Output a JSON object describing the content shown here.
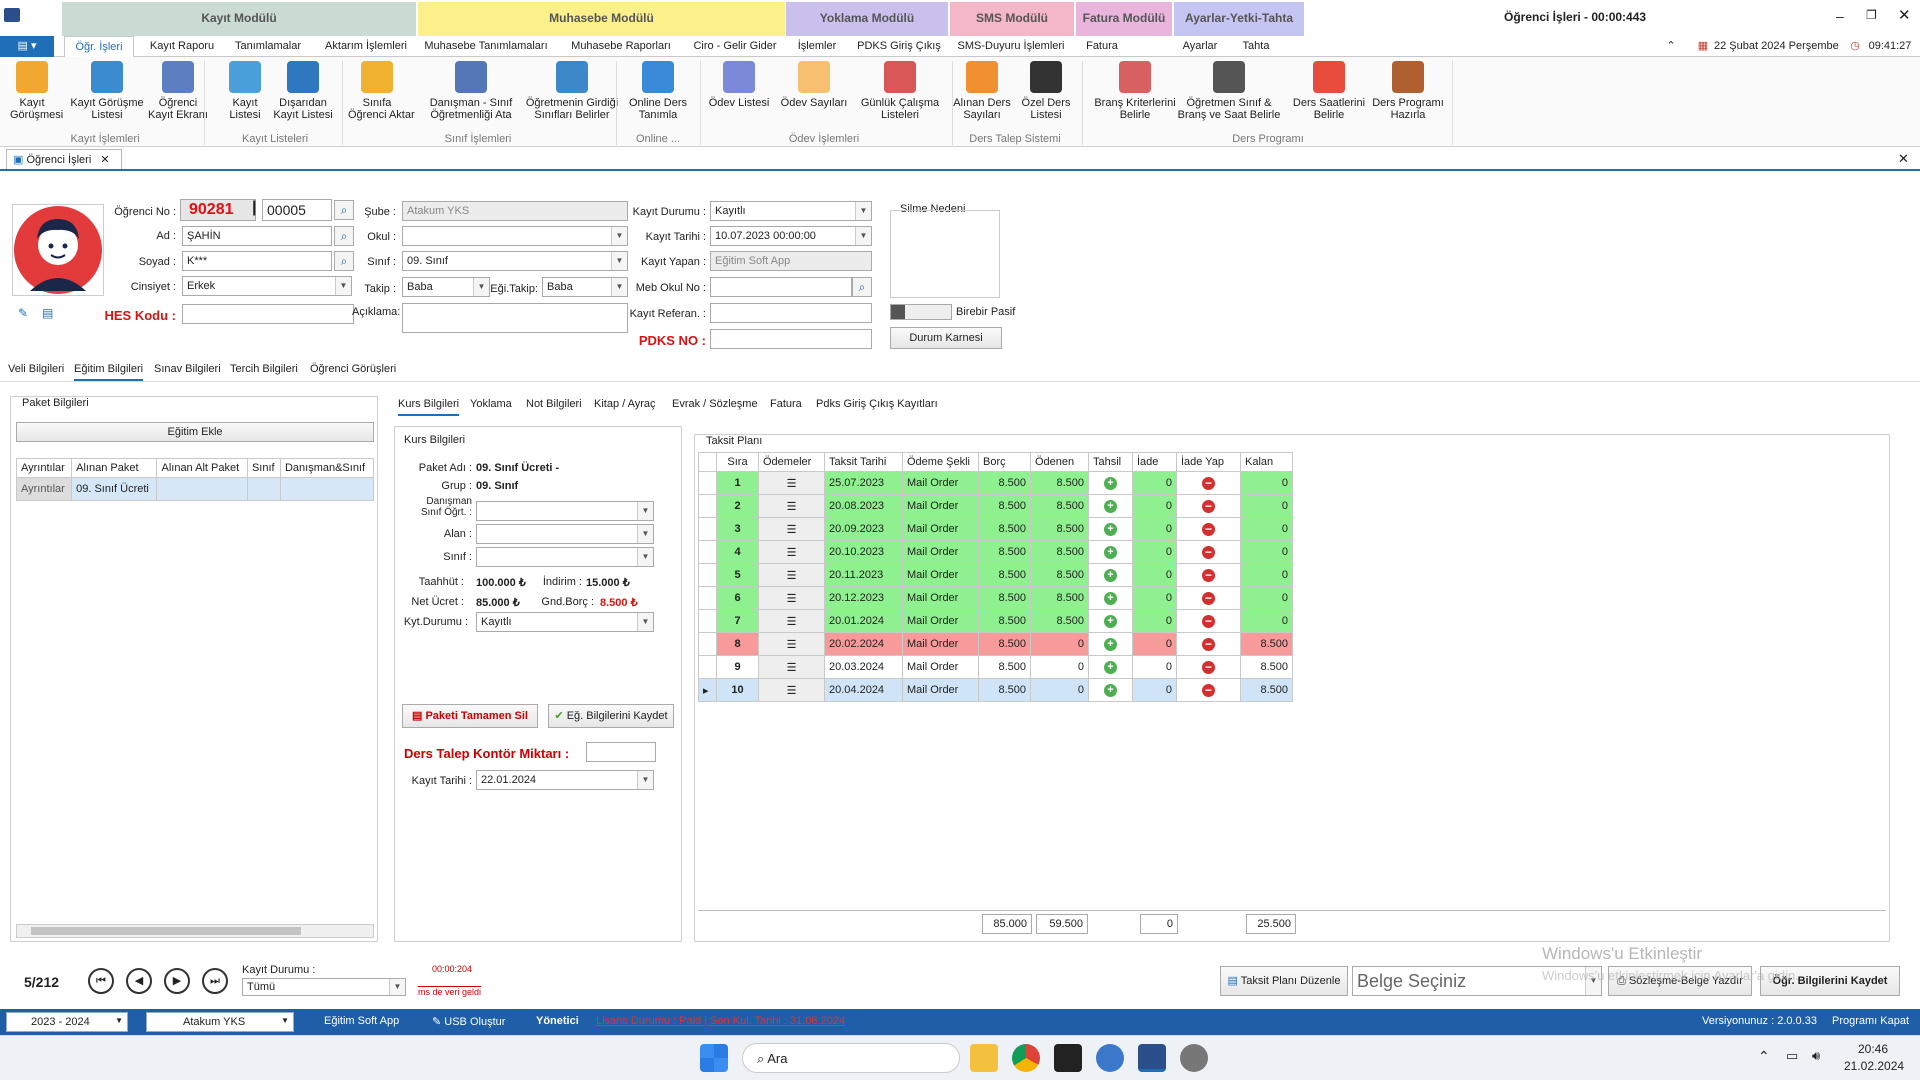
{
  "modules": [
    {
      "label": "Kayıt Modülü",
      "color": "#c9dbd3"
    },
    {
      "label": "Muhasebe Modülü",
      "color": "#fbf08a"
    },
    {
      "label": "Yoklama Modülü",
      "color": "#c9c0ee"
    },
    {
      "label": "SMS Modülü",
      "color": "#f3b7c8"
    },
    {
      "label": "Fatura Modülü",
      "color": "#e9b5dc"
    },
    {
      "label": "Ayarlar-Yetki-Tahta",
      "color": "#c5c5f3"
    }
  ],
  "window": {
    "title": "Öğrenci İşleri - 00:00:443",
    "date": "22 Şubat 2024 Perşembe",
    "time": "09:41:27"
  },
  "ribbon_tabs": [
    "Öğr. İşleri",
    "Kayıt Raporu",
    "Tanımlamalar",
    "Aktarım İşlemleri",
    "Muhasebe Tanımlamaları",
    "Muhasebe Raporları",
    "Ciro - Gelir Gider",
    "İşlemler",
    "PDKS Giriş Çıkış",
    "SMS-Duyuru İşlemleri",
    "Fatura",
    "Ayarlar",
    "Tahta"
  ],
  "ribbon_buttons": [
    {
      "label": "Kayıt\nGörüşmesi",
      "icon": "person-star-icon"
    },
    {
      "label": "Kayıt Görüşme\nListesi",
      "icon": "people-icon"
    },
    {
      "label": "Öğrenci\nKayıt Ekranı",
      "icon": "student-card-icon"
    },
    {
      "label": "Kayıt\nListesi",
      "icon": "people-list-icon"
    },
    {
      "label": "Dışarıdan\nKayıt Listesi",
      "icon": "walking-icon"
    },
    {
      "label": "Sınıfa\nÖğrenci Aktar",
      "icon": "db-add-icon"
    },
    {
      "label": "Danışman - Sınıf\nÖğretmenliği Ata",
      "icon": "teacher-icon"
    },
    {
      "label": "Öğretmenin Girdiği\nSınıfları Belirler",
      "icon": "board-icon"
    },
    {
      "label": "Online Ders\nTanımla",
      "icon": "globe-icon"
    },
    {
      "label": "Ödev Listesi",
      "icon": "pencil-icon"
    },
    {
      "label": "Ödev Sayıları",
      "icon": "image-icon"
    },
    {
      "label": "Günlük Çalışma\nListeleri",
      "icon": "pie-icon"
    },
    {
      "label": "Alınan Ders\nSayıları",
      "icon": "bar-chart-icon"
    },
    {
      "label": "Özel Ders\nListesi",
      "icon": "meeting-icon"
    },
    {
      "label": "Branş Kriterlerini\nBelirle",
      "icon": "calendar-icon"
    },
    {
      "label": "Öğretmen Sınıf &\nBranş ve Saat Belirle",
      "icon": "clock-doc-icon"
    },
    {
      "label": "Ders Saatlerini\nBelirle",
      "icon": "alarm-icon"
    },
    {
      "label": "Ders Programı\nHazırla",
      "icon": "teacher-board-icon"
    }
  ],
  "ribbon_groups": [
    "Kayıt İşlemleri",
    "Kayıt Listeleri",
    "Sınıf İşlemleri",
    "Online ...",
    "Ödev İşlemleri",
    "Ders Talep Sistemi",
    "Ders Programı"
  ],
  "doc_tab": "Öğrenci İşleri",
  "form": {
    "ogrenci_no_label": "Öğrenci No :",
    "ogrenci_no": "90281",
    "ogrenci_no_sep": "|",
    "ogrenci_no_sub": "00005",
    "ad_label": "Ad :",
    "ad": "ŞAHİN",
    "soyad_label": "Soyad :",
    "soyad": "K***",
    "cinsiyet_label": "Cinsiyet :",
    "cinsiyet": "Erkek",
    "hes_label": "HES Kodu :",
    "hes": "",
    "sube_label": "Şube :",
    "sube": "Atakum YKS",
    "okul_label": "Okul :",
    "okul": "",
    "sinif_label": "Sınıf :",
    "sinif": "09. Sınıf",
    "takip_label": "Takip :",
    "takip": "Baba",
    "egi_takip_label": "Eği.Takip:",
    "egi_takip": "Baba",
    "aciklama_label": "Açıklama:",
    "aciklama": "",
    "kayit_durumu_label": "Kayıt Durumu :",
    "kayit_durumu": "Kayıtlı",
    "kayit_tarihi_label": "Kayıt Tarihi :",
    "kayit_tarihi": "10.07.2023 00:00:00",
    "kayit_yapan_label": "Kayıt Yapan :",
    "kayit_yapan": "Eğitim Soft App",
    "meb_label": "Meb Okul No :",
    "meb": "",
    "referan_label": "Kayıt Referan. :",
    "referan": "",
    "pdks_label": "PDKS NO :",
    "pdks": "",
    "silme_label": "Silme Nedeni",
    "birebir_label": "Birebir Pasif",
    "durum_karnesi": "Durum Karnesi"
  },
  "info_tabs": [
    "Veli Bilgileri",
    "Eğitim Bilgileri",
    "Sınav Bilgileri",
    "Tercih Bilgileri",
    "Öğrenci Görüşleri"
  ],
  "paket": {
    "title": "Paket Bilgileri",
    "add_btn": "Eğitim Ekle",
    "columns": [
      "Ayrıntılar",
      "Alınan Paket",
      "Alınan Alt Paket",
      "Sınıf",
      "Danışman&Sınıf"
    ],
    "rows": [
      [
        "Ayrıntılar",
        "09. Sınıf Ücreti",
        "",
        "",
        ""
      ]
    ]
  },
  "kurs_tabs": [
    "Kurs Bilgileri",
    "Yoklama",
    "Not Bilgileri",
    "Kitap / Ayraç",
    "Evrak / Sözleşme",
    "Fatura",
    "Pdks Giriş Çıkış Kayıtları"
  ],
  "kurs": {
    "title": "Kurs Bilgileri",
    "paket_adi_label": "Paket Adı :",
    "paket_adi": "09. Sınıf Ücreti -",
    "grup_label": "Grup :",
    "grup": "09. Sınıf",
    "danisman_label": "Danışman\nSınıf Öğrt. :",
    "alan_label": "Alan :",
    "sinif_label": "Sınıf :",
    "taahhut_label": "Taahhüt :",
    "taahhut": "100.000 ₺",
    "indirim_label": "İndirim :",
    "indirim": "15.000 ₺",
    "net_label": "Net Ücret :",
    "net": "85.000 ₺",
    "gnd_label": "Gnd.Borç :",
    "gnd": "8.500 ₺",
    "kyt_label": "Kyt.Durumu :",
    "kyt": "Kayıtlı",
    "sil_btn": "Paketi Tamamen Sil",
    "kaydet_btn": "Eğ. Bilgilerini Kaydet",
    "kontor_label": "Ders Talep Kontör Miktarı :",
    "kayit_tarihi_label": "Kayıt Tarihi :",
    "kayit_tarihi": "22.01.2024"
  },
  "taksit": {
    "title": "Taksit Planı",
    "columns": [
      "Sıra",
      "Ödemeler",
      "Taksit Tarihi",
      "Ödeme Şekli",
      "Borç",
      "Ödenen",
      "Tahsil",
      "İade",
      "İade Yap",
      "Kalan"
    ],
    "rows": [
      {
        "sira": "1",
        "tarih": "25.07.2023",
        "sekil": "Mail Order",
        "borc": "8.500",
        "odenen": "8.500",
        "iade": "0",
        "kalan": "0",
        "status": "paid"
      },
      {
        "sira": "2",
        "tarih": "20.08.2023",
        "sekil": "Mail Order",
        "borc": "8.500",
        "odenen": "8.500",
        "iade": "0",
        "kalan": "0",
        "status": "paid"
      },
      {
        "sira": "3",
        "tarih": "20.09.2023",
        "sekil": "Mail Order",
        "borc": "8.500",
        "odenen": "8.500",
        "iade": "0",
        "kalan": "0",
        "status": "paid"
      },
      {
        "sira": "4",
        "tarih": "20.10.2023",
        "sekil": "Mail Order",
        "borc": "8.500",
        "odenen": "8.500",
        "iade": "0",
        "kalan": "0",
        "status": "paid"
      },
      {
        "sira": "5",
        "tarih": "20.11.2023",
        "sekil": "Mail Order",
        "borc": "8.500",
        "odenen": "8.500",
        "iade": "0",
        "kalan": "0",
        "status": "paid"
      },
      {
        "sira": "6",
        "tarih": "20.12.2023",
        "sekil": "Mail Order",
        "borc": "8.500",
        "odenen": "8.500",
        "iade": "0",
        "kalan": "0",
        "status": "paid"
      },
      {
        "sira": "7",
        "tarih": "20.01.2024",
        "sekil": "Mail Order",
        "borc": "8.500",
        "odenen": "8.500",
        "iade": "0",
        "kalan": "0",
        "status": "paid"
      },
      {
        "sira": "8",
        "tarih": "20.02.2024",
        "sekil": "Mail Order",
        "borc": "8.500",
        "odenen": "0",
        "iade": "0",
        "kalan": "8.500",
        "status": "overdue"
      },
      {
        "sira": "9",
        "tarih": "20.03.2024",
        "sekil": "Mail Order",
        "borc": "8.500",
        "odenen": "0",
        "iade": "0",
        "kalan": "8.500",
        "status": "open"
      },
      {
        "sira": "10",
        "tarih": "20.04.2024",
        "sekil": "Mail Order",
        "borc": "8.500",
        "odenen": "0",
        "iade": "0",
        "kalan": "8.500",
        "status": "selected"
      }
    ],
    "totals": {
      "borc": "85.000",
      "odenen": "59.500",
      "iade": "0",
      "kalan": "25.500"
    }
  },
  "footer": {
    "record": "5/212",
    "kayit_durumu_label": "Kayıt Durumu :",
    "kayit_durumu": "Tümü",
    "timer": "00:00:204",
    "timer_note": "ms de veri geldi",
    "taksit_btn": "Taksit Planı Düzenle",
    "belge_placeholder": "Belge Seçiniz",
    "sozlesme_btn": "Sözleşme-Belge Yazdır",
    "kaydet_btn": "Öğr. Bilgilerini Kaydet",
    "watermark1": "Windows'u Etkinleştir",
    "watermark2": "Windows'u etkinleştirmek için Ayarlar'a gidin."
  },
  "status": {
    "year": "2023 - 2024",
    "branch": "Atakum YKS",
    "app": "Eğitim Soft App",
    "usb": "USB Oluştur",
    "role": "Yönetici",
    "license": "Lisans Durumu : Paid | Son Kul. Tarihi : 31.08.2024",
    "version": "Versiyonunuz : 2.0.0.33",
    "close": "Programı Kapat"
  },
  "taskbar": {
    "search": "Ara",
    "time": "20:46",
    "date": "21.02.2024"
  }
}
